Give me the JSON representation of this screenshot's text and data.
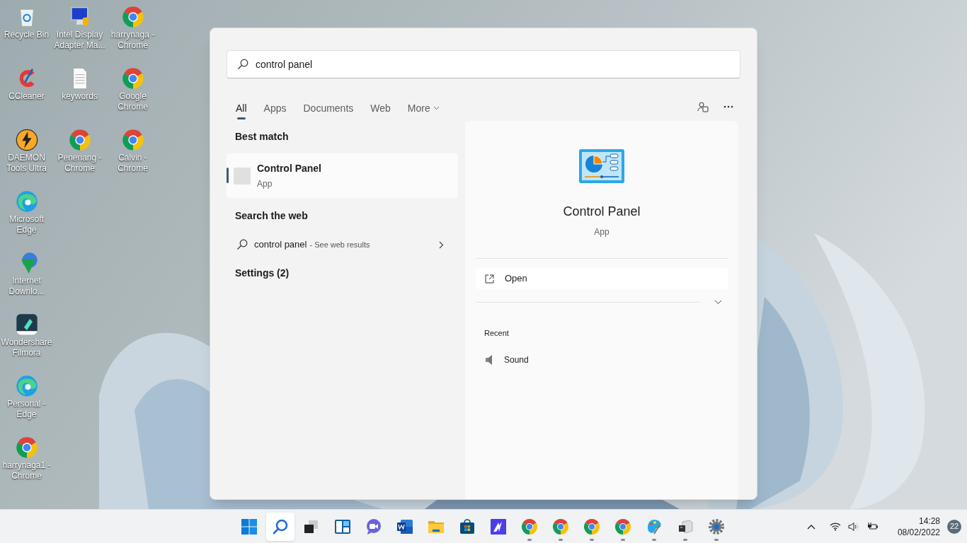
{
  "desktop": {
    "columns": [
      [
        {
          "kind": "recycle-bin",
          "label": "Recycle Bin"
        },
        {
          "kind": "ccleaner",
          "label": "CCleaner"
        },
        {
          "kind": "daemon",
          "label": "DAEMON Tools Ultra"
        },
        {
          "kind": "edge",
          "label": "Microsoft Edge"
        },
        {
          "kind": "downloader",
          "label": "Internet Downlo..."
        },
        {
          "kind": "filmora",
          "label": "Wondershare Filmora"
        },
        {
          "kind": "edge",
          "label": "Personal - Edge"
        },
        {
          "kind": "chrome",
          "label": "harrynaga1 - Chrome"
        }
      ],
      [
        {
          "kind": "monitor",
          "label": "Intel Display Adapter Ma..."
        },
        {
          "kind": "document",
          "label": "keywords"
        },
        {
          "kind": "chrome",
          "label": "Penenang - Chrome"
        }
      ],
      [
        {
          "kind": "chrome",
          "label": "harrynaga - Chrome"
        },
        {
          "kind": "chrome",
          "label": "Google Chrome"
        },
        {
          "kind": "chrome",
          "label": "Calvin - Chrome"
        }
      ]
    ]
  },
  "search": {
    "query": "control panel",
    "tabs": [
      {
        "kind": "tab",
        "label": "All",
        "selected": true
      },
      {
        "kind": "tab",
        "label": "Apps",
        "selected": false
      },
      {
        "kind": "tab",
        "label": "Documents",
        "selected": false
      },
      {
        "kind": "tab",
        "label": "Web",
        "selected": false
      },
      {
        "kind": "dropdown",
        "label": "More",
        "selected": false
      }
    ],
    "best_match_heading": "Best match",
    "best_match": {
      "title": "Control Panel",
      "subtitle": "App",
      "selected": true
    },
    "web_heading": "Search the web",
    "web_query": "control panel",
    "web_hint": "- See web results",
    "settings_heading": "Settings (2)",
    "detail": {
      "title": "Control Panel",
      "subtitle": "App",
      "open_label": "Open",
      "recent_heading": "Recent",
      "recent": [
        {
          "label": "Sound"
        }
      ]
    }
  },
  "taskbar": {
    "apps": [
      {
        "kind": "start",
        "selected": false,
        "running": false
      },
      {
        "kind": "search",
        "selected": true,
        "running": false
      },
      {
        "kind": "task-view",
        "selected": false,
        "running": false
      },
      {
        "kind": "widgets",
        "selected": false,
        "running": false
      },
      {
        "kind": "chat",
        "selected": false,
        "running": false
      },
      {
        "kind": "word",
        "selected": false,
        "running": false
      },
      {
        "kind": "folder",
        "selected": false,
        "running": false
      },
      {
        "kind": "store",
        "selected": false,
        "running": false
      },
      {
        "kind": "editor",
        "selected": false,
        "running": false
      },
      {
        "kind": "chrome",
        "selected": false,
        "running": true
      },
      {
        "kind": "chrome",
        "selected": false,
        "running": true
      },
      {
        "kind": "chrome",
        "selected": false,
        "running": true
      },
      {
        "kind": "chrome",
        "selected": false,
        "running": true
      },
      {
        "kind": "paint",
        "selected": false,
        "running": true
      },
      {
        "kind": "device",
        "selected": false,
        "running": true
      },
      {
        "kind": "settings",
        "selected": false,
        "running": true
      }
    ],
    "time": "14:28",
    "date": "08/02/2022",
    "notifications": "22"
  }
}
